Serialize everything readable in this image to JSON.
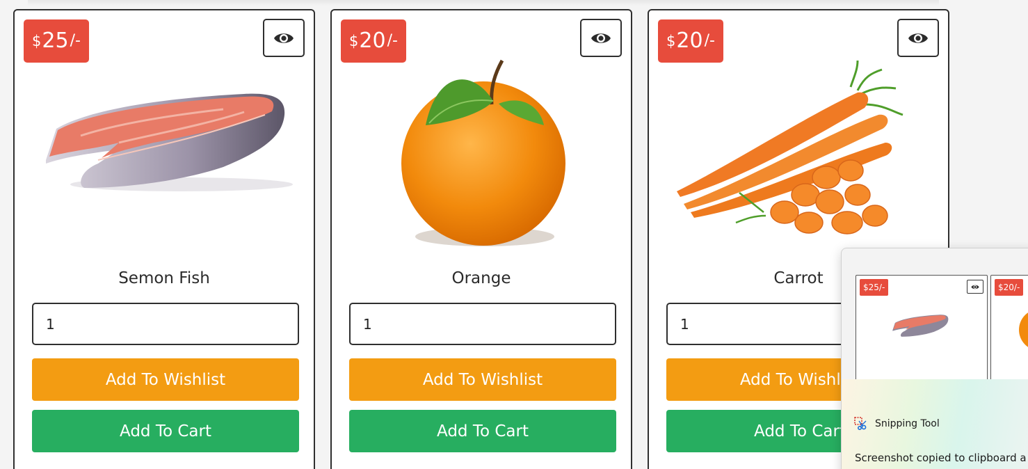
{
  "products": [
    {
      "name": "Semon Fish",
      "price_currency": "$",
      "price": "25",
      "price_suffix": "/-",
      "qty": "1",
      "wishlist_label": "Add To Wishlist",
      "cart_label": "Add To Cart",
      "image": "salmon-steak-image"
    },
    {
      "name": "Orange",
      "price_currency": "$",
      "price": "20",
      "price_suffix": "/-",
      "qty": "1",
      "wishlist_label": "Add To Wishlist",
      "cart_label": "Add To Cart",
      "image": "orange-image"
    },
    {
      "name": "Carrot",
      "price_currency": "$",
      "price": "20",
      "price_suffix": "/-",
      "qty": "1",
      "wishlist_label": "Add To Wishlist",
      "cart_label": "Add To Cart",
      "image": "carrots-image"
    }
  ],
  "snipping_tool": {
    "app_name": "Snipping Tool",
    "message": "Screenshot copied to clipboard a",
    "thumb_prices": [
      "$25/-",
      "$20/-"
    ]
  },
  "colors": {
    "price_badge": "#e74c3c",
    "wishlist_button": "#f39c12",
    "cart_button": "#27ae60",
    "card_border": "#2f2f2f"
  },
  "icons": {
    "view": "eye-icon",
    "snip": "snipping-tool-icon"
  }
}
